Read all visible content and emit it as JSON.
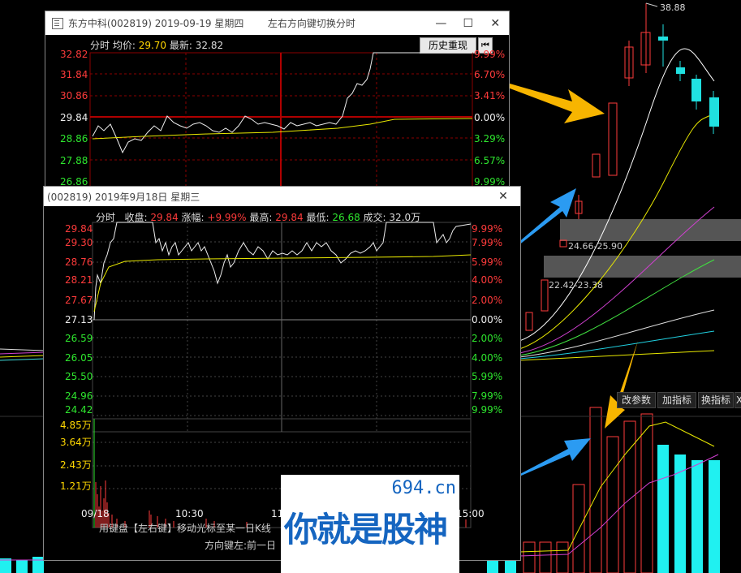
{
  "background_chart": {
    "high_label": "38.88",
    "band1_label": "24.66-25.90",
    "band2_label": "22.42-23.38",
    "param_label": "改参数",
    "add_indicator": "加指标",
    "switch_indicator": "换指标",
    "close_x": "X"
  },
  "window1": {
    "title": "东方中科(002819) 2019-09-19 星期四",
    "hint": "左右方向键切换分时",
    "header_prefix": "分时 均价:",
    "avg_price": "29.70",
    "latest_prefix": "最新:",
    "latest": "32.82",
    "history_replay": "历史重现",
    "y_left": [
      "32.82",
      "31.84",
      "30.86",
      "29.84",
      "28.86",
      "27.88",
      "26.86"
    ],
    "y_right": [
      "9.99%",
      "6.70%",
      "3.41%",
      "0.00%",
      "3.29%",
      "6.57%",
      "9.99%"
    ]
  },
  "window2": {
    "title": "(002819) 2019年9月18日 星期三",
    "header": {
      "label1": "分时",
      "close_label": "收盘:",
      "close": "29.84",
      "change_label": "涨幅:",
      "change": "+9.99%",
      "high_label": "最高:",
      "high": "29.84",
      "low_label": "最低:",
      "low": "26.68",
      "vol_label": "成交:",
      "vol": "32.0万"
    },
    "y_left": [
      "29.84",
      "29.30",
      "28.76",
      "28.21",
      "27.67",
      "27.13",
      "26.59",
      "26.05",
      "25.50",
      "24.96",
      "24.42"
    ],
    "y_right": [
      "9.99%",
      "7.99%",
      "5.99%",
      "4.00%",
      "2.00%",
      "0.00%",
      "2.00%",
      "4.00%",
      "5.99%",
      "7.99%",
      "9.99%"
    ],
    "vol_left": [
      "4.85万",
      "3.64万",
      "2.43万",
      "1.21万"
    ],
    "x_labels": [
      "09/18",
      "10:30",
      "11",
      "15:00"
    ],
    "footer1": "用键盘【左右键】移动光标至某一日K线",
    "footer2": "方向键左:前一日"
  },
  "watermark": {
    "site": "694.cn",
    "slogan": "你就是股神"
  }
}
